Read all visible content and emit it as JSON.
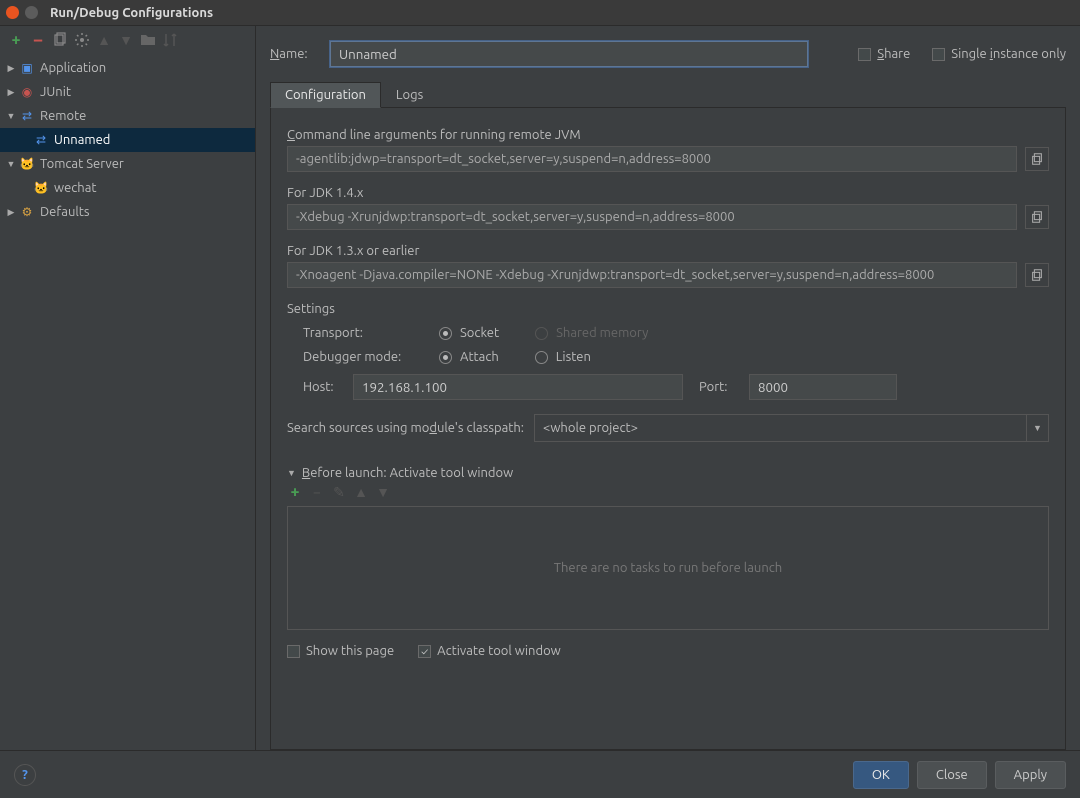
{
  "window": {
    "title": "Run/Debug Configurations"
  },
  "sidebar": {
    "items": [
      {
        "label": "Application",
        "expandable": true
      },
      {
        "label": "JUnit",
        "expandable": true
      },
      {
        "label": "Remote",
        "expandable": true,
        "expanded": true,
        "children": [
          {
            "label": "Unnamed",
            "selected": true
          }
        ]
      },
      {
        "label": "Tomcat Server",
        "expandable": true,
        "expanded": true,
        "children": [
          {
            "label": "wechat"
          }
        ]
      },
      {
        "label": "Defaults",
        "expandable": true
      }
    ]
  },
  "header": {
    "name_label": "Name:",
    "name_value": "Unnamed",
    "share_label": "Share",
    "single_instance_label": "Single instance only"
  },
  "tabs": [
    {
      "label": "Configuration",
      "active": true
    },
    {
      "label": "Logs"
    }
  ],
  "config": {
    "cmd_label": "Command line arguments for running remote JVM",
    "cmd_value": "-agentlib:jdwp=transport=dt_socket,server=y,suspend=n,address=8000",
    "jdk14_label": "For JDK 1.4.x",
    "jdk14_value": "-Xdebug -Xrunjdwp:transport=dt_socket,server=y,suspend=n,address=8000",
    "jdk13_label": "For JDK 1.3.x or earlier",
    "jdk13_value": "-Xnoagent -Djava.compiler=NONE -Xdebug -Xrunjdwp:transport=dt_socket,server=y,suspend=n,address=8000",
    "settings_label": "Settings",
    "transport_label": "Transport:",
    "transport_socket": "Socket",
    "transport_shared": "Shared memory",
    "debugger_mode_label": "Debugger mode:",
    "mode_attach": "Attach",
    "mode_listen": "Listen",
    "host_label": "Host:",
    "host_value": "192.168.1.100",
    "port_label": "Port:",
    "port_value": "8000",
    "module_label": "Search sources using module's classpath:",
    "module_value": "<whole project>"
  },
  "before_launch": {
    "title": "Before launch: Activate tool window",
    "empty_text": "There are no tasks to run before launch",
    "show_page_label": "Show this page",
    "activate_label": "Activate tool window",
    "activate_checked": true
  },
  "footer": {
    "ok": "OK",
    "close": "Close",
    "apply": "Apply"
  }
}
